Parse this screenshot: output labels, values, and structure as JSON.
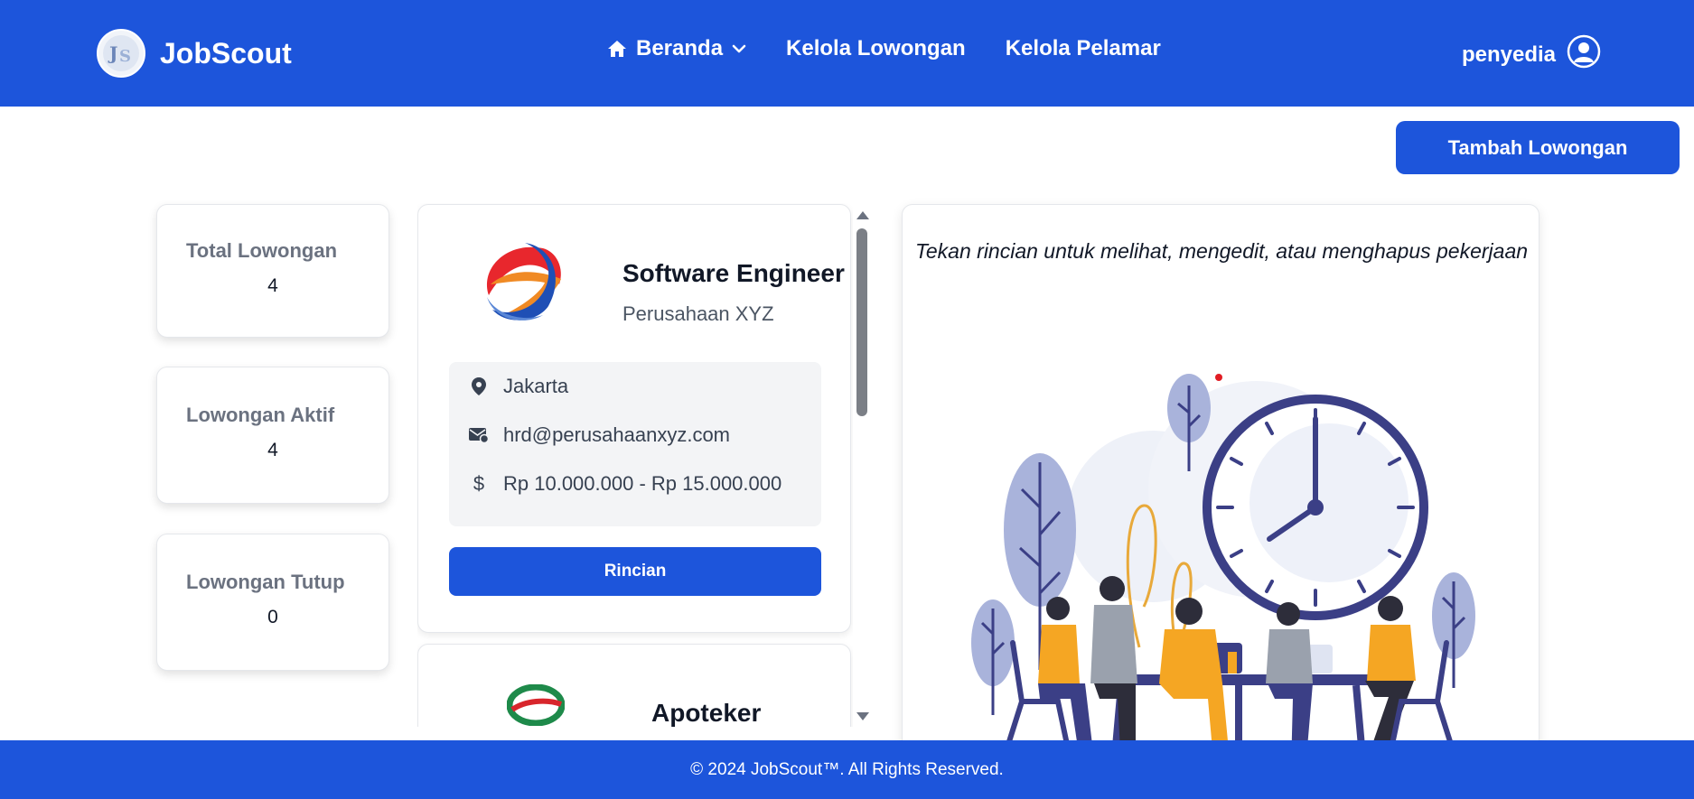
{
  "brand": {
    "name": "JobScout",
    "logo_icon": "js-logo-icon"
  },
  "nav": {
    "links": [
      {
        "label": "Beranda",
        "icon": "home-icon",
        "dropdown": true
      },
      {
        "label": "Kelola Lowongan"
      },
      {
        "label": "Kelola Pelamar"
      }
    ],
    "user": {
      "name": "penyedia",
      "icon": "user-circle-icon"
    }
  },
  "actions": {
    "add_job_label": "Tambah Lowongan"
  },
  "stats": [
    {
      "label": "Total Lowongan",
      "value": "4"
    },
    {
      "label": "Lowongan Aktif",
      "value": "4"
    },
    {
      "label": "Lowongan Tutup",
      "value": "0"
    }
  ],
  "jobs": [
    {
      "title": "Software Engineer",
      "company": "Perusahaan XYZ",
      "location": "Jakarta",
      "email": "hrd@perusahaanxyz.com",
      "salary": "Rp 10.000.000 - Rp 15.000.000",
      "button_label": "Rincian"
    },
    {
      "title": "Apoteker"
    }
  ],
  "detail_panel": {
    "hint": "Tekan rincian untuk melihat, mengedit, atau menghapus pekerjaan"
  },
  "footer": {
    "text": "© 2024 JobScout™. All Rights Reserved."
  },
  "colors": {
    "primary": "#1d55db",
    "panel_bg": "#f3f4f6",
    "illustration_accent": "#f5a623",
    "illustration_navy": "#3b3f86"
  }
}
